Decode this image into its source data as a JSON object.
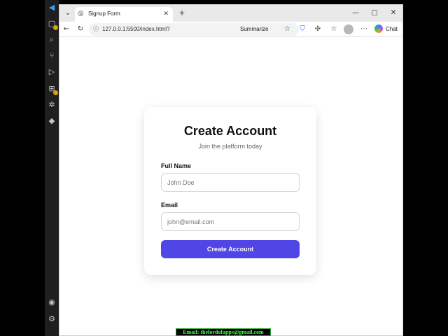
{
  "browser": {
    "tab": {
      "title": "Signup Form",
      "close_glyph": "✕"
    },
    "new_tab_glyph": "+",
    "url": "127.0.0.1:5500/index.html?",
    "summarize_label": "Summarize",
    "chat_label": "Chat"
  },
  "form": {
    "title": "Create Account",
    "subtitle": "Join the platform today",
    "full_name": {
      "label": "Full Name",
      "placeholder": "John Doe",
      "value": ""
    },
    "email": {
      "label": "Email",
      "placeholder": "john@email.com",
      "value": ""
    },
    "submit_label": "Create Account",
    "accent_color": "#4f46e5"
  },
  "footer": {
    "banner_text": "Email: thelordofapps@gmail.com"
  },
  "icons": {
    "tab_menu": "chevron-down-icon",
    "favicon": "globe-icon",
    "back": "back-arrow-icon",
    "reload": "reload-icon",
    "favorite": "star-icon",
    "extensions": "puzzle-icon",
    "profile": "avatar"
  }
}
